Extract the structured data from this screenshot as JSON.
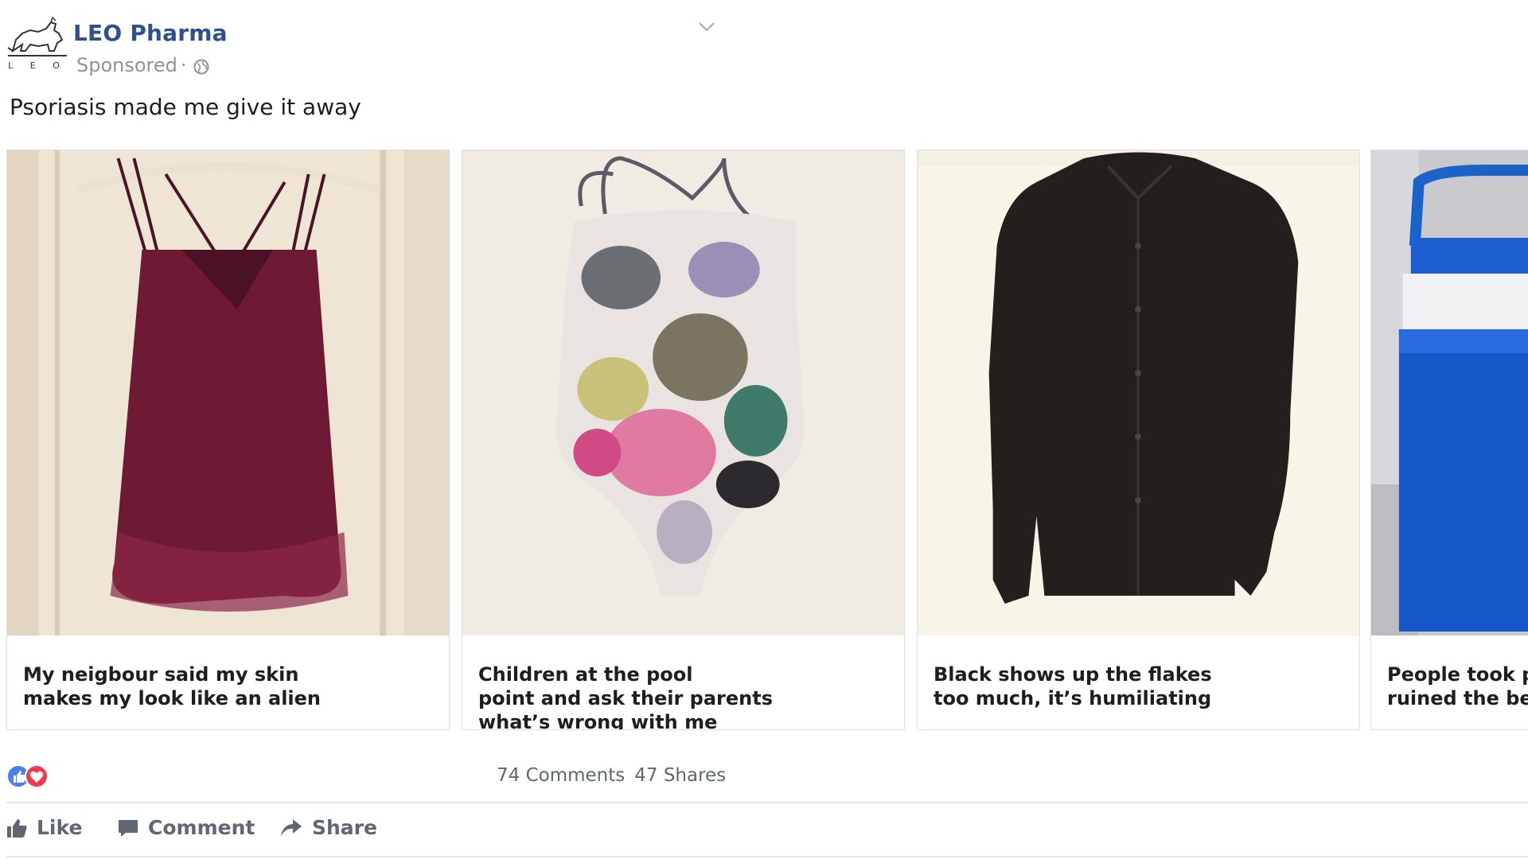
{
  "post": {
    "page_name": "LEO Pharma",
    "logo_text": "L E O",
    "sponsored_label": "Sponsored",
    "separator": "·",
    "text": "Psoriasis made me give it away"
  },
  "carousel": {
    "cards": [
      {
        "caption": "My neigbour said my skin\nmakes my look like an alien",
        "image": "burgundy-camisole-photo"
      },
      {
        "caption": "Children at the pool\npoint and ask their parents\nwhat’s wrong with me",
        "image": "floral-swimsuit-photo"
      },
      {
        "caption": "Black shows up the flakes\ntoo much, it’s humiliating",
        "image": "black-shirt-photo"
      },
      {
        "caption": "People took pi\nruined the bea",
        "image": "blue-cooler-photo"
      }
    ]
  },
  "engagement": {
    "reactions": [
      "like-icon",
      "love-icon"
    ],
    "comments": "74 Comments",
    "shares": "47 Shares"
  },
  "actions": {
    "like": "Like",
    "comment": "Comment",
    "share": "Share"
  },
  "colors": {
    "page_name": "#2f4f8f",
    "like_blue": "#4a7ff0",
    "love_red": "#f0384f",
    "muted": "#606770"
  }
}
